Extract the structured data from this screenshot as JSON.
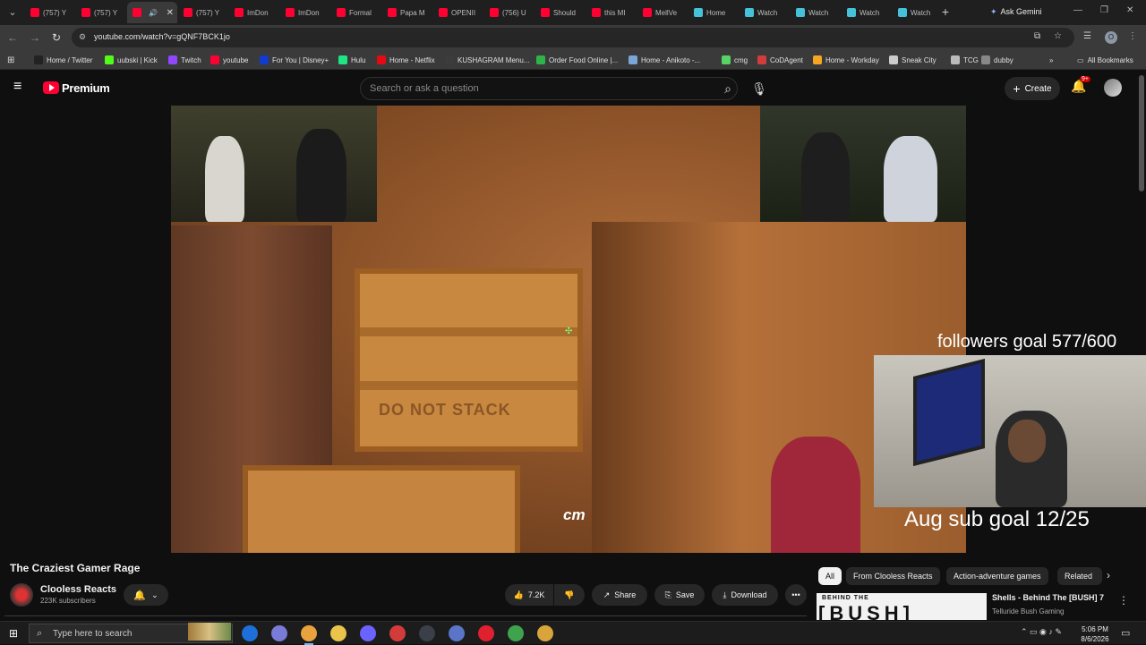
{
  "browser": {
    "tabs": [
      {
        "label": "(757) Y",
        "color": "#ff0033"
      },
      {
        "label": "(757) Y",
        "color": "#ff0033"
      },
      {
        "label": "",
        "color": "#ff0033",
        "active": true
      },
      {
        "label": "(757) Y",
        "color": "#ff0033"
      },
      {
        "label": "ImDon",
        "color": "#ff0033"
      },
      {
        "label": "ImDon",
        "color": "#ff0033"
      },
      {
        "label": "Formal",
        "color": "#ff0033"
      },
      {
        "label": "Papa M",
        "color": "#ff0033"
      },
      {
        "label": "OPENII",
        "color": "#ff0033"
      },
      {
        "label": "(756) U",
        "color": "#ff0033"
      },
      {
        "label": "Should",
        "color": "#ff0033"
      },
      {
        "label": "this MI",
        "color": "#ff0033"
      },
      {
        "label": "MellVe",
        "color": "#ff0033"
      },
      {
        "label": "Home",
        "color": "#45c1d9"
      },
      {
        "label": "Watch",
        "color": "#45c1d9"
      },
      {
        "label": "Watch",
        "color": "#45c1d9"
      },
      {
        "label": "Watch",
        "color": "#45c1d9"
      },
      {
        "label": "Watch",
        "color": "#45c1d9"
      }
    ],
    "new_tab": "+",
    "ask_gemini": "Ask Gemini",
    "url": "youtube.com/watch?v=gQNF7BCK1jo",
    "profile_initial": "O",
    "bookmarks": [
      {
        "label": "Home / Twitter",
        "color": "#222222"
      },
      {
        "label": "uubski | Kick",
        "color": "#53fc18"
      },
      {
        "label": "Twitch",
        "color": "#9146ff"
      },
      {
        "label": "youtube",
        "color": "#ff0033"
      },
      {
        "label": "For You | Disney+",
        "color": "#113ccf"
      },
      {
        "label": "Hulu",
        "color": "#1ce783"
      },
      {
        "label": "Home - Netflix",
        "color": "#e50914"
      },
      {
        "label": "KUSHAGRAM Menu...",
        "color": "#3c3c3c"
      },
      {
        "label": "Order Food Online |...",
        "color": "#2db34a"
      },
      {
        "label": "Home - Anikoto -...",
        "color": "#7aa6d8"
      },
      {
        "label": "cmg",
        "color": "#56d364"
      },
      {
        "label": "CoDAgent",
        "color": "#d23c3c"
      },
      {
        "label": "Home - Workday",
        "color": "#f5a623"
      },
      {
        "label": "Sneak City",
        "color": "#cccccc"
      },
      {
        "label": "TCG",
        "color": "#bbbbbb"
      },
      {
        "label": "dubby",
        "color": "#888888"
      }
    ],
    "all_bookmarks": "All Bookmarks"
  },
  "youtube": {
    "brand": "Premium",
    "search_placeholder": "Search or ask a question",
    "create_label": "Create",
    "notif_count": "9+",
    "video": {
      "title": "The Craziest Gamer Rage",
      "crate_stencil": "DO NOT STACK",
      "overlay_text": "cm",
      "followers_goal": "followers goal 577/600",
      "sub_goal": "Aug sub goal 12/25"
    },
    "channel": {
      "name": "Clooless Reacts",
      "subs": "223K subscribers"
    },
    "actions": {
      "likes": "7.2K",
      "share": "Share",
      "save": "Save",
      "download": "Download"
    },
    "chips": [
      "All",
      "From Clooless Reacts",
      "Action-adventure games",
      "Related"
    ],
    "recommendation": {
      "thumb_small": "BEHIND THE",
      "thumb_big": "[BUSH]",
      "title": "Shells - Behind The [BUSH] 7",
      "channel": "Telluride Bush Gaming"
    }
  },
  "taskbar": {
    "search_text": "Type here to search",
    "time": "5:06 PM",
    "date": "8/6/2026",
    "apps": [
      {
        "name": "edge-icon",
        "color": "#1e6fd9"
      },
      {
        "name": "chrome-profile-icon",
        "color": "#7a7ad8"
      },
      {
        "name": "chrome-icon",
        "color": "#e8a33d",
        "active": true
      },
      {
        "name": "file-explorer-icon",
        "color": "#e9c34a"
      },
      {
        "name": "discord-icon",
        "color": "#6c63ff"
      },
      {
        "name": "media-player-icon",
        "color": "#d33b3b"
      },
      {
        "name": "steam-icon",
        "color": "#3a3f4a"
      },
      {
        "name": "app-icon",
        "color": "#5a74c8"
      },
      {
        "name": "acrobat-icon",
        "color": "#e0202f"
      },
      {
        "name": "chrome-icon-2",
        "color": "#3fa34d"
      },
      {
        "name": "chrome-icon-3",
        "color": "#d9a53a"
      }
    ]
  }
}
